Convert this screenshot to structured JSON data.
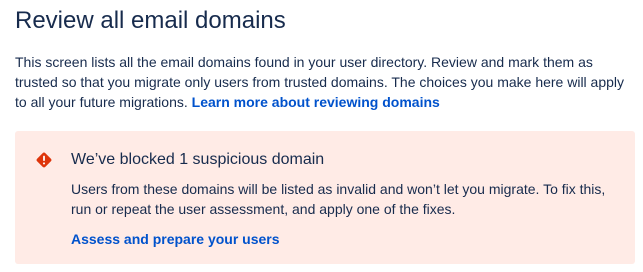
{
  "header": {
    "title": "Review all email domains"
  },
  "intro": {
    "text": "This screen lists all the email domains found in your user directory. Review and mark them as trusted so that you migrate only users from trusted domains. The choices you make here will apply to all your future migrations. ",
    "link_label": "Learn more about reviewing domains"
  },
  "alert": {
    "icon": "error-icon",
    "icon_color": "#de350b",
    "background": "#ffebe6",
    "title": "We’ve blocked 1 suspicious domain",
    "body": "Users from these domains will be listed as invalid and won’t let you migrate. To fix this, run or repeat the user assessment, and apply one of the fixes.",
    "link_label": "Assess and prepare your users"
  },
  "colors": {
    "text": "#172b4d",
    "link": "#0052cc"
  }
}
